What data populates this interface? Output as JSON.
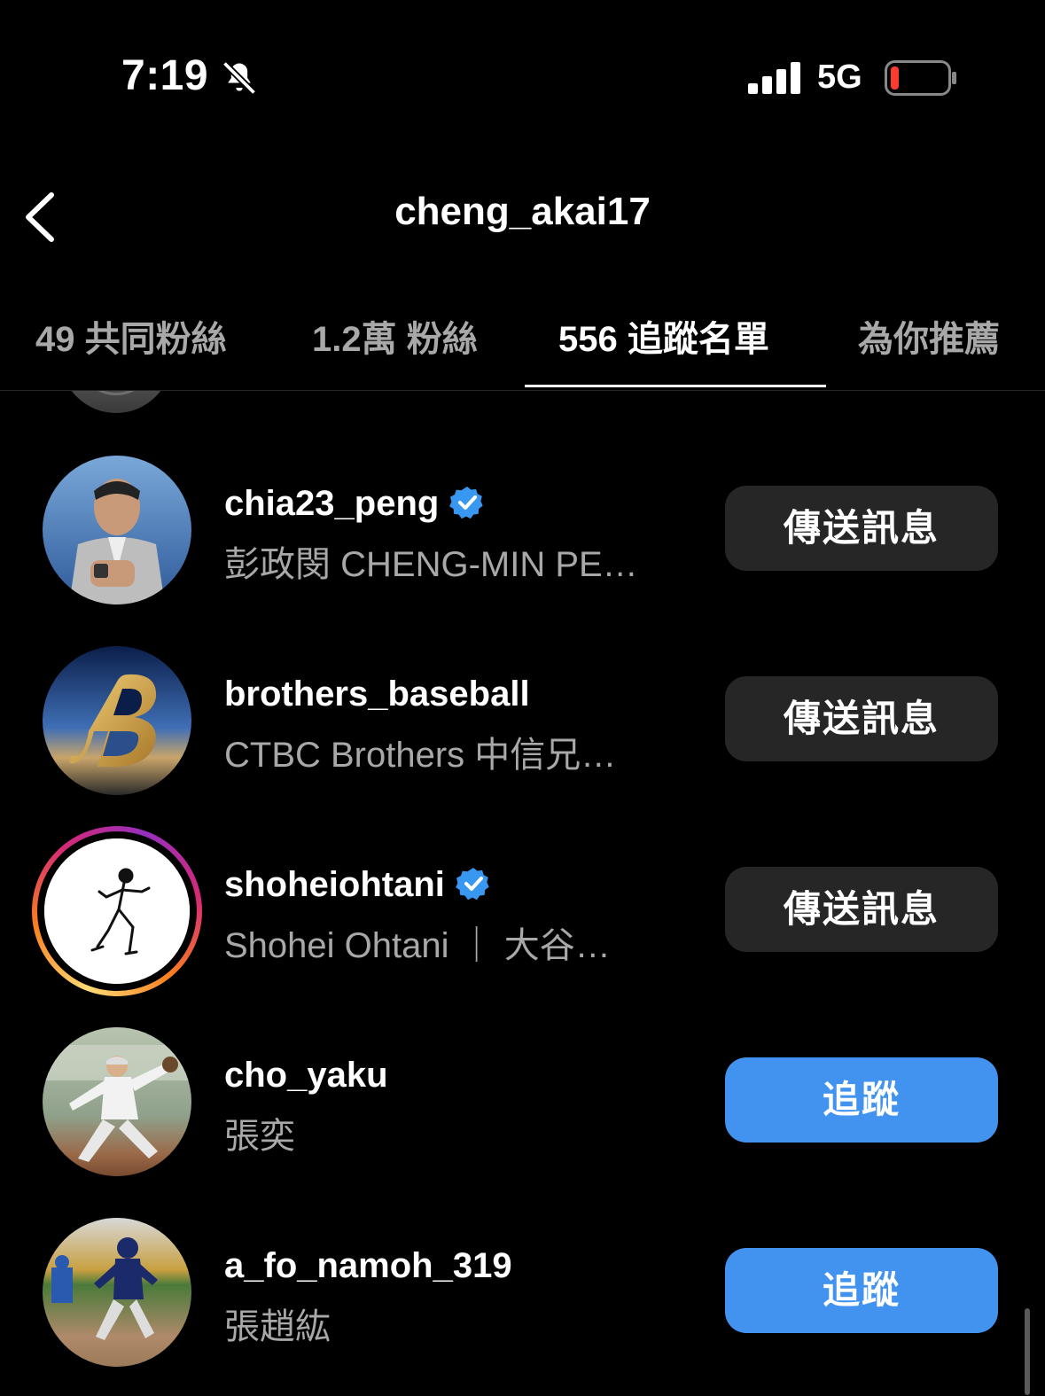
{
  "status_bar": {
    "time": "7:19",
    "network": "5G",
    "battery_color": "#ff3b30"
  },
  "header": {
    "title": "cheng_akai17"
  },
  "tabs": [
    {
      "label": "49 共同粉絲",
      "active": false
    },
    {
      "label": "1.2萬 粉絲",
      "active": false
    },
    {
      "label": "556 追蹤名單",
      "active": true
    },
    {
      "label": "為你推薦",
      "active": false
    }
  ],
  "users": [
    {
      "username": "chia23_peng",
      "verified": true,
      "fullname": "彭政閔 CHENG-MIN PE…",
      "button": "傳送訊息",
      "button_style": "secondary"
    },
    {
      "username": "brothers_baseball",
      "verified": false,
      "fullname": "CTBC Brothers 中信兄…",
      "button": "傳送訊息",
      "button_style": "secondary"
    },
    {
      "username": "shoheiohtani",
      "verified": true,
      "fullname": "Shohei Ohtani ｜ 大谷…",
      "button": "傳送訊息",
      "button_style": "secondary",
      "has_story": true
    },
    {
      "username": "cho_yaku",
      "verified": false,
      "fullname": "張奕",
      "button": "追蹤",
      "button_style": "primary"
    },
    {
      "username": "a_fo_namoh_319",
      "verified": false,
      "fullname": "張趙紘",
      "button": "追蹤",
      "button_style": "primary"
    }
  ],
  "colors": {
    "accent": "#4193ef",
    "secondary_button": "#262626",
    "muted_text": "#a8a8a8",
    "verified": "#3897f0"
  }
}
